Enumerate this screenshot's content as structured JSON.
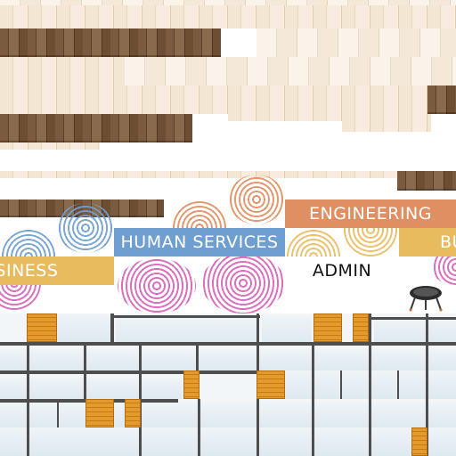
{
  "texture": {
    "signs": {
      "engineering": "ENGINEERING",
      "human_services": "HUMAN SERVICES",
      "business_partial_right": "BU",
      "business_partial_left": "USINESS",
      "admin": "ADMIN"
    },
    "colors": {
      "wood_light": "#f3e6d3",
      "wood_dark": "#7b5a3f",
      "engineering_orange": "#e08f63",
      "human_services_blue": "#6f9fd1",
      "business_yellow": "#e9bb5f",
      "swirl_pink": "#d760b8",
      "glass_frame": "#4e4e4e",
      "shelf_orange": "#e59a2c"
    },
    "icons": [
      "grill-icon",
      "swirl-decoration"
    ]
  }
}
